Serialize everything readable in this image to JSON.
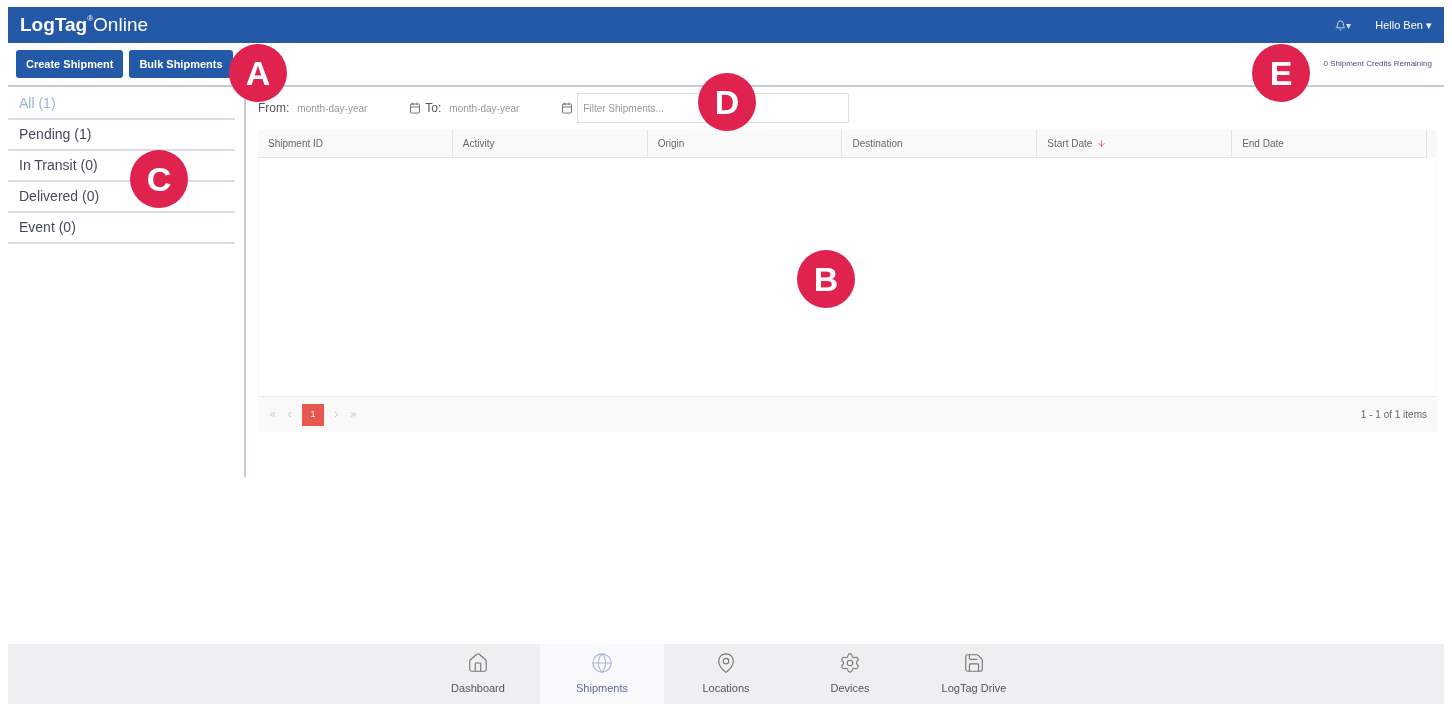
{
  "header": {
    "logo": {
      "brand": "LogTag",
      "mark": "®",
      "product": "Online"
    },
    "notifications": {
      "label": "▾"
    },
    "user": {
      "label": "Hello Ben ▾"
    }
  },
  "toolbar": {
    "buttons": [
      "Create Shipment",
      "Bulk Shipments"
    ],
    "credits": "0 Shipment Credits Remaining"
  },
  "sidebar": {
    "items": [
      {
        "label": "All (1)",
        "selected": true
      },
      {
        "label": "Pending (1)",
        "selected": false
      },
      {
        "label": "In Transit (0)",
        "selected": false
      },
      {
        "label": "Delivered (0)",
        "selected": false
      },
      {
        "label": "Event (0)",
        "selected": false
      }
    ]
  },
  "filters": {
    "from_label": "From:",
    "from_placeholder": "month-day-year",
    "to_label": "To:",
    "to_placeholder": "month-day-year",
    "search_placeholder": "Filter Shipments..."
  },
  "table": {
    "columns": [
      {
        "label": "Shipment ID",
        "sorted": false
      },
      {
        "label": "Activity",
        "sorted": false
      },
      {
        "label": "Origin",
        "sorted": false
      },
      {
        "label": "Destination",
        "sorted": false
      },
      {
        "label": "Start Date",
        "sorted": true
      },
      {
        "label": "End Date",
        "sorted": false
      }
    ]
  },
  "pager": {
    "pages": [
      {
        "label": "1",
        "selected": true
      }
    ],
    "summary": "1 - 1 of 1 items"
  },
  "bottom_nav": [
    {
      "label": "Dashboard",
      "kind": "home",
      "selected": false
    },
    {
      "label": "Shipments",
      "kind": "globe",
      "selected": true
    },
    {
      "label": "Locations",
      "kind": "pin",
      "selected": false
    },
    {
      "label": "Devices",
      "kind": "gear",
      "selected": false
    },
    {
      "label": "LogTag Drive",
      "kind": "disk",
      "selected": false
    }
  ],
  "callouts": [
    {
      "label": "A",
      "kind": "toolbar"
    },
    {
      "label": "B",
      "kind": "table"
    },
    {
      "label": "C",
      "kind": "sidebar"
    },
    {
      "label": "D",
      "kind": "filters"
    },
    {
      "label": "E",
      "kind": "credits"
    }
  ]
}
